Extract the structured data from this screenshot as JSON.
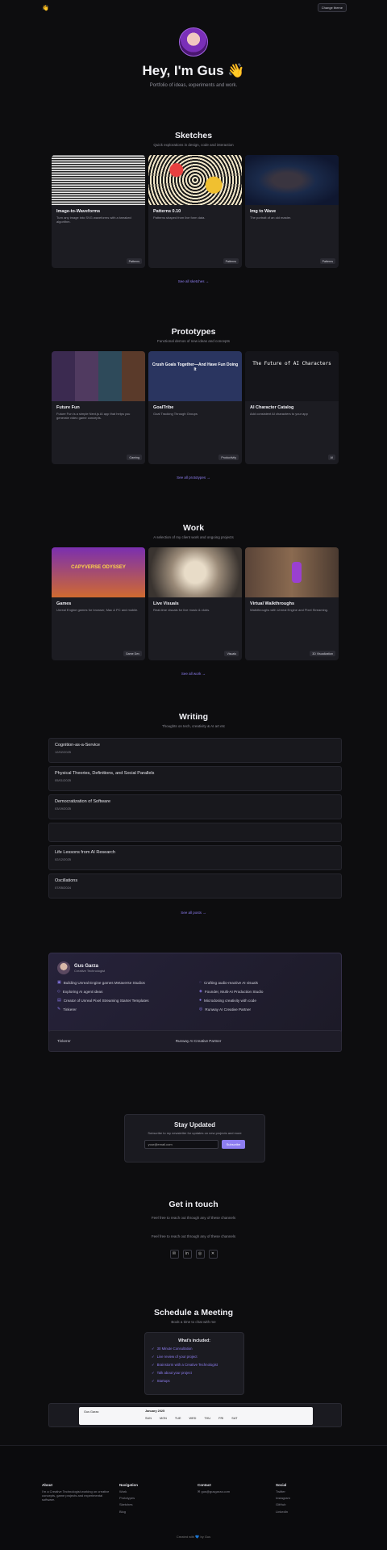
{
  "header": {
    "logo": "👋",
    "theme_label": "Change theme"
  },
  "hero": {
    "title": "Hey, I'm Gus 👋",
    "subtitle": "Portfolio of ideas, experiments and work."
  },
  "sketches": {
    "title": "Sketches",
    "subtitle": "Quick explorations in design, code and interaction",
    "cards": [
      {
        "title": "Image-to-Waveforms",
        "desc": "Turn any image into SVG waveforms with a tweaked algorithm.",
        "tag": "Patterns"
      },
      {
        "title": "Patterns 0.10",
        "desc": "Patterns shaped from live form data.",
        "tag": "Patterns"
      },
      {
        "title": "Img to Wave",
        "desc": "The portrait of an old master.",
        "tag": "Patterns"
      }
    ],
    "see_all": "See all sketches →"
  },
  "prototypes": {
    "title": "Prototypes",
    "subtitle": "Functional demos of new ideas and concepts",
    "cards": [
      {
        "title": "Future Fun",
        "desc": "Future Fun is a simple Next.js AI app that helps you generate video game concepts.",
        "tag": "Gaming"
      },
      {
        "title": "GoalTribe",
        "desc": "Goal Tracking Through Groups",
        "tag": "Productivity"
      },
      {
        "title": "AI Character Catalog",
        "desc": "Add consistent AI characters to your app",
        "tag": "AI"
      }
    ],
    "see_all": "See all prototypes →",
    "banner_text": "Crush Goals Together—And Have Fun Doing It",
    "ai_heading": "The Future of AI Characters"
  },
  "work": {
    "title": "Work",
    "subtitle": "A selection of my client work and ongoing projects",
    "cards": [
      {
        "title": "Games",
        "desc": "Unreal Engine games for browser, Mac & PC and mobile.",
        "tag": "Game Dev"
      },
      {
        "title": "Live Visuals",
        "desc": "Real-time visuals for live music & clubs.",
        "tag": "Visuals"
      },
      {
        "title": "Virtual Walkthroughs",
        "desc": "Walkthroughs with Unreal Engine and Pixel Streaming.",
        "tag": "3D Visualization"
      }
    ],
    "see_all": "See all work →",
    "game_logo": "CAPYVERSE ODYSSEY"
  },
  "writing": {
    "title": "Writing",
    "subtitle": "Thoughts on tech, creativity & AI art etc",
    "posts": [
      {
        "title": "Cognition-as-a-Service",
        "date": "12/02/2025"
      },
      {
        "title": "Physical Theories, Definitions, and Social Parallels",
        "date": "05/01/2025"
      },
      {
        "title": "Democratization of Software",
        "date": "03/19/2025"
      },
      {
        "title": "",
        "date": ""
      },
      {
        "title": "Life Lessons from AI Research",
        "date": "02/12/2025"
      },
      {
        "title": "Oscillations",
        "date": "07/05/2024"
      }
    ],
    "see_all": "See all posts →"
  },
  "github": {
    "name": "Gus Garza",
    "role": "Creative Technologist",
    "items": [
      "Building Unreal Engine games Metaverse Studios",
      "Crafting audio-reactive AI visuals",
      "Exploring AI agent ideas",
      "Founder, Multi-AI Production Studio",
      "Creator of Unreal Pixel Streaming Starter Templates",
      "Microdosing creativity with code",
      "Tinkerer",
      "Runway AI Creative Partner"
    ],
    "strip_left": "Tinkerer",
    "strip_right": "Runway AI Creative Partner"
  },
  "subscribe": {
    "title": "Stay Updated",
    "desc": "Subscribe to my newsletter for updates on new projects and more",
    "placeholder": "your@email.com",
    "button": "Subscribe"
  },
  "contact": {
    "title": "Get in touch",
    "desc1": "Feel free to reach out through any of these channels",
    "desc2": "Feel free to reach out through any of these channels",
    "socials": [
      "✉",
      "in",
      "◎",
      "✕"
    ]
  },
  "meeting": {
    "title": "Schedule a Meeting",
    "subtitle": "Book a time to chat with me",
    "box_title": "What's included:",
    "items": [
      "30 Minute Consultation",
      "Live review of your project",
      "Brainstorm with a Creative Technologist",
      "Talk about your project",
      "Startups"
    ]
  },
  "calendar": {
    "month": "January 2025",
    "days": [
      "SUN",
      "MON",
      "TUE",
      "WED",
      "THU",
      "FRI",
      "SAT"
    ],
    "name": "Gus Garza",
    "year": "2025"
  },
  "footer": {
    "about_h": "About",
    "about_text": "I'm a Creative Technologist working on creative concepts, game projects and experimental software.",
    "nav_h": "Navigation",
    "nav": [
      "Work",
      "Prototypes",
      "Sketches",
      "Blog"
    ],
    "contact_h": "Contact",
    "contact_items": [
      "✉ gus@gusgarza.com"
    ],
    "social_h": "Social",
    "social": [
      "Twitter",
      "Instagram",
      "GitHub",
      "LinkedIn"
    ],
    "copyright": "Created with 💙 by Gus"
  }
}
